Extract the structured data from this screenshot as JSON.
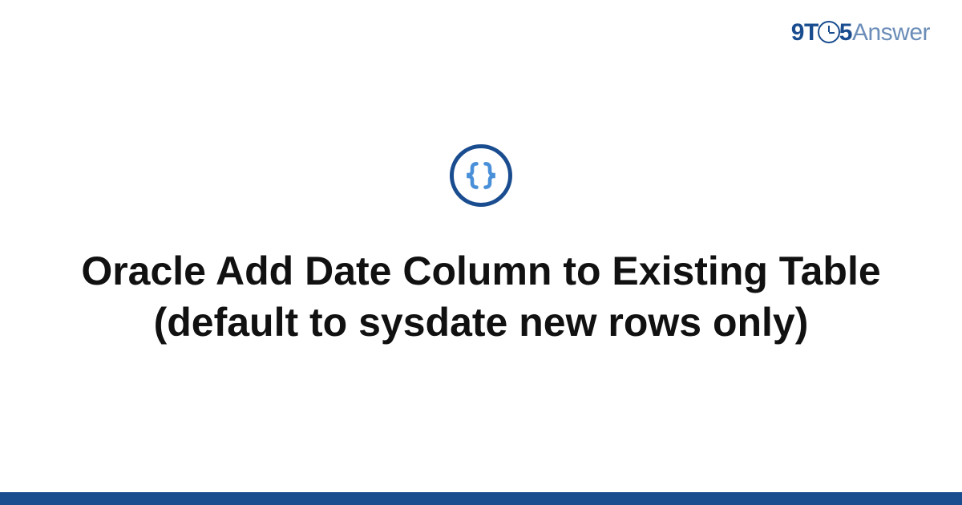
{
  "brand": {
    "part1": "9",
    "part2": "T",
    "part3": "5",
    "part4": "Answer"
  },
  "icon": {
    "name": "code-brackets"
  },
  "title": "Oracle Add Date Column to Existing Table (default to sysdate new rows only)",
  "colors": {
    "accent": "#1a4d8f",
    "accentLight": "#6b8db8",
    "text": "#111111"
  }
}
